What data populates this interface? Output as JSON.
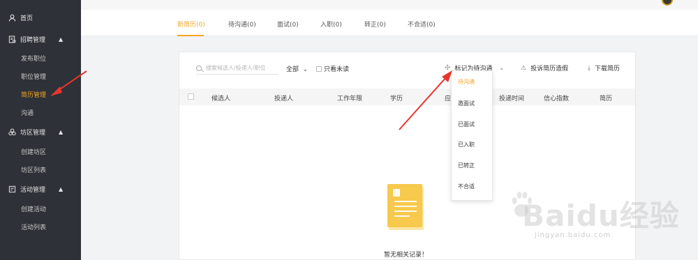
{
  "sidebar": {
    "home": "首页",
    "groups": [
      {
        "label": "招聘管理",
        "items": [
          "发布职位",
          "职位管理",
          "简历管理",
          "沟通"
        ]
      },
      {
        "label": "坊区管理",
        "items": [
          "创建坊区",
          "坊区列表"
        ]
      },
      {
        "label": "活动管理",
        "items": [
          "创建活动",
          "活动列表"
        ]
      }
    ],
    "active_item": "简历管理"
  },
  "tabs": [
    "新简历(0)",
    "待沟通(0)",
    "面试(0)",
    "入职(0)",
    "转正(0)",
    "不合适(0)"
  ],
  "toolbar": {
    "search_placeholder": "搜索候选人/投递人/职位",
    "filter_all": "全部",
    "unread_only": "只看未读",
    "mark_as": "标记为待沟通",
    "complain": "投诉简历造假",
    "download": "下载简历"
  },
  "table": {
    "columns": [
      "候选人",
      "投递人",
      "工作年限",
      "学历",
      "应聘",
      "投递时间",
      "信心指数",
      "简历"
    ]
  },
  "dropdown": {
    "options": [
      "待沟通",
      "邀面试",
      "已面试",
      "已入职",
      "已转正",
      "不合适"
    ],
    "selected": "待沟通"
  },
  "empty_text": "暂无相关记录！",
  "watermark": {
    "main": "Baidu经验",
    "url": "jingyan.baidu.com"
  },
  "colors": {
    "accent": "#f5a623",
    "sidebar_bg": "#2e3138",
    "annotation_arrow": "#e8352b"
  }
}
